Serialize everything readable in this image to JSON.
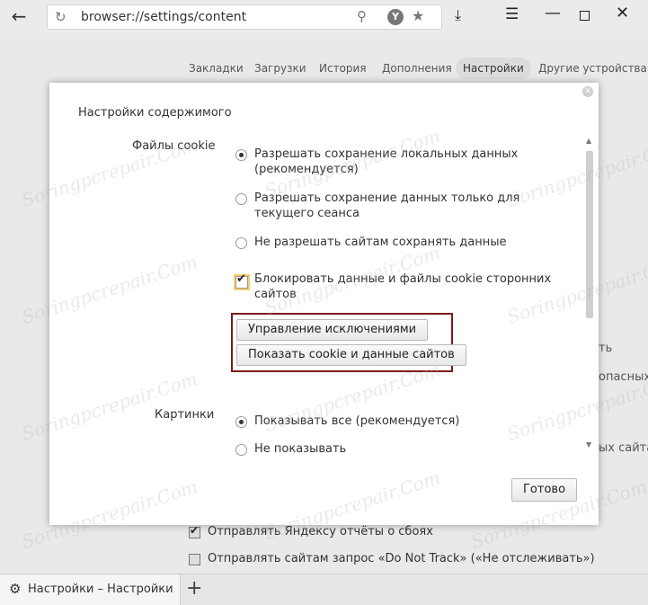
{
  "browser": {
    "url": "browser://settings/content",
    "ya_badge": "Y"
  },
  "nav": {
    "tabs": [
      "Закладки",
      "Загрузки",
      "История",
      "Дополнения",
      "Настройки",
      "Другие устройства"
    ],
    "active": "Настройки"
  },
  "background": {
    "fragment_1": "ть",
    "fragment_2": "опасных",
    "fragment_3": "ых сайтах",
    "send_reports_label": "Отправлять Яндексу отчёты о сбоях",
    "send_reports_checked": true,
    "do_not_track_label": "Отправлять сайтам запрос «Do Not Track» («Не отслеживать»)",
    "do_not_track_checked": false
  },
  "dialog": {
    "title": "Настройки содержимого",
    "cookies": {
      "label": "Файлы cookie",
      "options": [
        {
          "label": "Разрешать сохранение локальных данных (рекомендуется)",
          "checked": true
        },
        {
          "label": "Разрешать сохранение данных только для текущего сеанса",
          "checked": false
        },
        {
          "label": "Не разрешать сайтам сохранять данные",
          "checked": false
        }
      ],
      "block_third_party_label": "Блокировать данные и файлы cookie сторонних сайтов",
      "block_third_party_checked": true,
      "manage_exceptions_button": "Управление исключениями",
      "show_cookies_button": "Показать cookie и данные сайтов"
    },
    "images": {
      "label": "Картинки",
      "options": [
        {
          "label": "Показывать все (рекомендуется)",
          "checked": true
        },
        {
          "label": "Не показывать",
          "checked": false
        }
      ]
    },
    "done_button": "Готово"
  },
  "tabstrip": {
    "tab_title": "Настройки – Настройки"
  },
  "watermark": "Sоringрсrераir.Cоm"
}
